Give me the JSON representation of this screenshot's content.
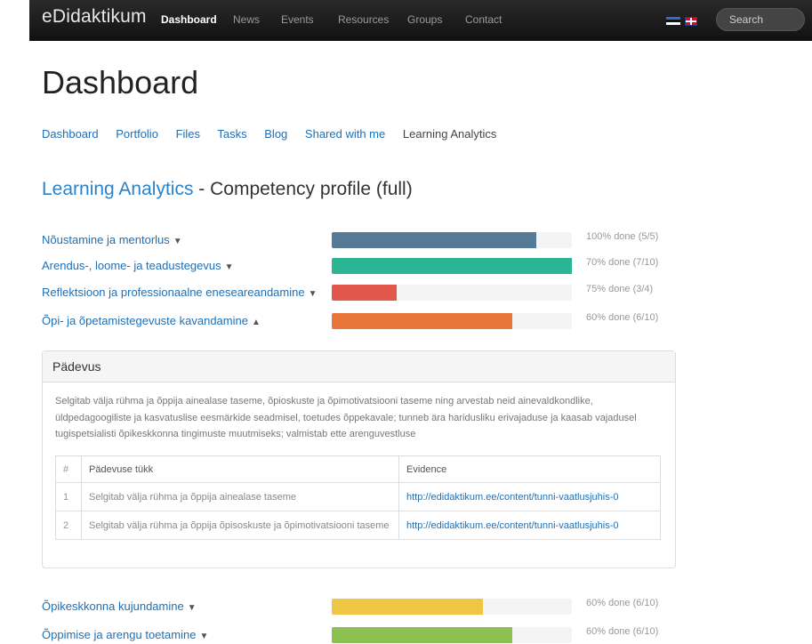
{
  "navbar": {
    "brand": "eDidaktikum",
    "links": [
      "Dashboard",
      "News",
      "Events",
      "Resources",
      "Groups",
      "Contact"
    ],
    "search_placeholder": "Search"
  },
  "page_title": "Dashboard",
  "subnav": [
    "Dashboard",
    "Portfolio",
    "Files",
    "Tasks",
    "Blog",
    "Shared with me",
    "Learning Analytics"
  ],
  "section": {
    "link": "Learning Analytics",
    "rest": " - Competency profile (full)"
  },
  "competencies": [
    {
      "label": "Nõustamine ja mentorlus",
      "chevron": "down",
      "progress": 0.85,
      "color": "#557a95",
      "status": "100% done (5/5)"
    },
    {
      "label": "Arendus-, loome- ja teadustegevus",
      "chevron": "down",
      "progress": 1.0,
      "color": "#2bb595",
      "status": "70% done (7/10)"
    },
    {
      "label": "Reflektsioon ja professionaalne eneseareandamine",
      "chevron": "down",
      "progress": 0.27,
      "color": "#e2574c",
      "status": "75% done (3/4)"
    },
    {
      "label": "Õpi- ja õpetamistegevuste kavandamine",
      "chevron": "up",
      "progress": 0.75,
      "color": "#e8763a",
      "status": "60% done (6/10)"
    },
    {
      "label": "Õpikeskkonna kujundamine",
      "chevron": "down",
      "progress": 0.63,
      "color": "#eec643",
      "status": "60% done (6/10)"
    },
    {
      "label": "Õppimise ja arengu toetamine",
      "chevron": "down",
      "progress": 0.75,
      "color": "#8cc152",
      "status": "60% done (6/10)"
    }
  ],
  "panel": {
    "heading": "Pädevus",
    "description": "Selgitab välja rühma ja õppija ainealase taseme, õpioskuste ja õpimotivatsiooni taseme ning arvestab neid ainevaldkondlike, üldpedagoogiliste ja kasvatuslise eesmärkide seadmisel, toetudes õppekavale; tunneb ära haridusliku erivajaduse ja kaasab vajadusel tugispetsialisti õpikeskkonna tingimuste muutmiseks; valmistab ette arenguvestluse",
    "table": {
      "headers": [
        "#",
        "Pädevuse tükk",
        "Evidence"
      ],
      "rows": [
        [
          "1",
          "Selgitab välja rühma ja õppija ainealase taseme",
          "http://edidaktikum.ee/content/tunni-vaatlusjuhis-0"
        ],
        [
          "2",
          "Selgitab välja rühma ja õppija õpisoskuste ja õpimotivatsiooni taseme",
          "http://edidaktikum.ee/content/tunni-vaatlusjuhis-0"
        ]
      ]
    }
  },
  "colors": {
    "navbar": "#1a1a1a",
    "link": "#1f6fb5",
    "accent_title": "#2b82c9"
  }
}
